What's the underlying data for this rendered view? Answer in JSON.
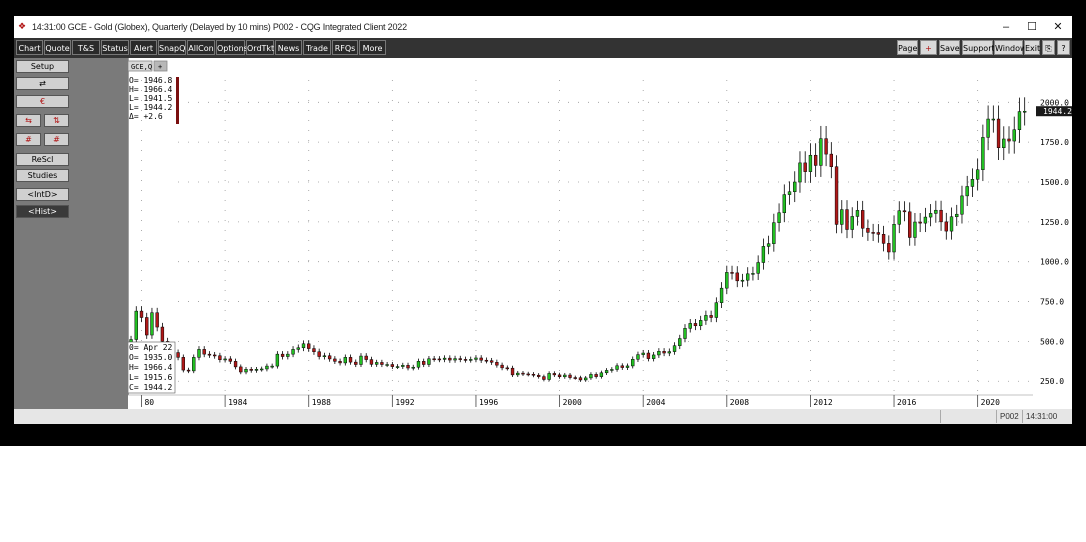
{
  "window": {
    "title": "14:31:00   GCE - Gold (Globex), Quarterly (Delayed by 10 mins)   P002 - CQG Integrated Client 2022",
    "minimize": "–",
    "maximize": "☐",
    "close": "✕"
  },
  "toolbar": {
    "left": [
      "Chart",
      "Quote",
      "T&S",
      "Status",
      "Alert",
      "SnapQ",
      "AllCon",
      "Options",
      "OrdTkt",
      "News",
      "Trade",
      "RFQs",
      "More"
    ],
    "right": [
      "Page",
      "+",
      "Save",
      "Support",
      "Window",
      "Exit",
      "⎘",
      "?"
    ]
  },
  "sidebar": {
    "setup": "Setup",
    "icon1": "⇄",
    "icon2": "€",
    "icon3a": "⇆",
    "icon3b": "⇅",
    "icon4a": "#",
    "icon4b": "#",
    "rescl": "ReScl",
    "studies": "Studies",
    "intd": "<IntD>",
    "hist": "<Hist>"
  },
  "symbol_tab": "GCE,Q",
  "quote_box": {
    "o": "O=  1946.8",
    "h": "H=  1966.4",
    "l": "L=  1941.5",
    "c": "L=  1944.2",
    "d": "Δ=    +2.6"
  },
  "cursor_box": {
    "date": "0=  Apr 22",
    "o": "O=  1935.0",
    "h": "H=  1966.4",
    "l": "L=  1915.6",
    "c": "C=  1944.2"
  },
  "last_price_label": "1944.2",
  "statusbar": {
    "page": "P002",
    "time": "14:31:00"
  },
  "colors": {
    "up": "#22c022",
    "down": "#b01818",
    "grid": "#999999",
    "frame": "#000000",
    "panel": "#7a7a7a"
  },
  "chart_data": {
    "type": "candlestick",
    "title": "GCE - Gold (Globex), Quarterly",
    "y_ticks": [
      250,
      500,
      750,
      1000,
      1250,
      1500,
      1750,
      2000
    ],
    "y_tick_labels": [
      "250.0",
      "500.0",
      "750.0",
      "1000.0",
      "1250.0",
      "1500.0",
      "1750.0",
      "2000.0"
    ],
    "ylim": [
      170,
      2140
    ],
    "x_ticks": [
      1980,
      1984,
      1988,
      1992,
      1996,
      2000,
      2004,
      2008,
      2012,
      2016,
      2020
    ],
    "x_tick_labels": [
      "80",
      "1984",
      "1988",
      "1992",
      "1996",
      "2000",
      "2004",
      "2008",
      "2012",
      "2016",
      "2020"
    ],
    "xlim": [
      1979.45,
      2022.6
    ],
    "grid": true,
    "last_price": 1944.2,
    "series_points": [
      [
        1979.5,
        512
      ],
      [
        1979.75,
        690
      ],
      [
        1980.0,
        650
      ],
      [
        1980.25,
        540
      ],
      [
        1980.5,
        680
      ],
      [
        1980.75,
        590
      ],
      [
        1981.0,
        500
      ],
      [
        1981.25,
        430
      ],
      [
        1981.5,
        430
      ],
      [
        1981.75,
        400
      ],
      [
        1982.0,
        320
      ],
      [
        1982.25,
        315
      ],
      [
        1982.5,
        400
      ],
      [
        1982.75,
        450
      ],
      [
        1983.0,
        420
      ],
      [
        1983.25,
        415
      ],
      [
        1983.5,
        410
      ],
      [
        1983.75,
        385
      ],
      [
        1984.0,
        390
      ],
      [
        1984.25,
        375
      ],
      [
        1984.5,
        340
      ],
      [
        1984.75,
        308
      ],
      [
        1985.0,
        325
      ],
      [
        1985.25,
        318
      ],
      [
        1985.5,
        325
      ],
      [
        1985.75,
        327
      ],
      [
        1986.0,
        345
      ],
      [
        1986.25,
        345
      ],
      [
        1986.5,
        420
      ],
      [
        1986.75,
        405
      ],
      [
        1987.0,
        420
      ],
      [
        1987.25,
        450
      ],
      [
        1987.5,
        460
      ],
      [
        1987.75,
        485
      ],
      [
        1988.0,
        455
      ],
      [
        1988.25,
        435
      ],
      [
        1988.5,
        405
      ],
      [
        1988.75,
        410
      ],
      [
        1989.0,
        390
      ],
      [
        1989.25,
        375
      ],
      [
        1989.5,
        365
      ],
      [
        1989.75,
        400
      ],
      [
        1990.0,
        370
      ],
      [
        1990.25,
        355
      ],
      [
        1990.5,
        408
      ],
      [
        1990.75,
        386
      ],
      [
        1991.0,
        356
      ],
      [
        1991.25,
        368
      ],
      [
        1991.5,
        355
      ],
      [
        1991.75,
        355
      ],
      [
        1992.0,
        342
      ],
      [
        1992.25,
        342
      ],
      [
        1992.5,
        350
      ],
      [
        1992.75,
        333
      ],
      [
        1993.0,
        338
      ],
      [
        1993.25,
        375
      ],
      [
        1993.5,
        355
      ],
      [
        1993.75,
        391
      ],
      [
        1994.0,
        390
      ],
      [
        1994.25,
        387
      ],
      [
        1994.5,
        395
      ],
      [
        1994.75,
        383
      ],
      [
        1995.0,
        392
      ],
      [
        1995.25,
        387
      ],
      [
        1995.5,
        384
      ],
      [
        1995.75,
        387
      ],
      [
        1996.0,
        396
      ],
      [
        1996.25,
        382
      ],
      [
        1996.5,
        379
      ],
      [
        1996.75,
        369
      ],
      [
        1997.0,
        351
      ],
      [
        1997.25,
        334
      ],
      [
        1997.5,
        332
      ],
      [
        1997.75,
        290
      ],
      [
        1998.0,
        301
      ],
      [
        1998.25,
        296
      ],
      [
        1998.5,
        294
      ],
      [
        1998.75,
        288
      ],
      [
        1999.0,
        279
      ],
      [
        1999.25,
        261
      ],
      [
        1999.5,
        299
      ],
      [
        1999.75,
        290
      ],
      [
        2000.0,
        278
      ],
      [
        2000.25,
        289
      ],
      [
        2000.5,
        273
      ],
      [
        2000.75,
        272
      ],
      [
        2001.0,
        258
      ],
      [
        2001.25,
        271
      ],
      [
        2001.5,
        293
      ],
      [
        2001.75,
        279
      ],
      [
        2002.0,
        303
      ],
      [
        2002.25,
        318
      ],
      [
        2002.5,
        324
      ],
      [
        2002.75,
        347
      ],
      [
        2003.0,
        336
      ],
      [
        2003.25,
        346
      ],
      [
        2003.5,
        388
      ],
      [
        2003.75,
        417
      ],
      [
        2004.0,
        427
      ],
      [
        2004.25,
        392
      ],
      [
        2004.5,
        415
      ],
      [
        2004.75,
        438
      ],
      [
        2005.0,
        427
      ],
      [
        2005.25,
        436
      ],
      [
        2005.5,
        473
      ],
      [
        2005.75,
        518
      ],
      [
        2006.0,
        582
      ],
      [
        2006.25,
        613
      ],
      [
        2006.5,
        598
      ],
      [
        2006.75,
        632
      ],
      [
        2007.0,
        663
      ],
      [
        2007.25,
        650
      ],
      [
        2007.5,
        743
      ],
      [
        2007.75,
        834
      ],
      [
        2008.0,
        933
      ],
      [
        2008.25,
        930
      ],
      [
        2008.5,
        880
      ],
      [
        2008.75,
        884
      ],
      [
        2009.0,
        924
      ],
      [
        2009.25,
        927
      ],
      [
        2009.5,
        995
      ],
      [
        2009.75,
        1096
      ],
      [
        2010.0,
        1113
      ],
      [
        2010.25,
        1245
      ],
      [
        2010.5,
        1307
      ],
      [
        2010.75,
        1421
      ],
      [
        2011.0,
        1439
      ],
      [
        2011.25,
        1500
      ],
      [
        2011.5,
        1620
      ],
      [
        2011.75,
        1565
      ],
      [
        2012.0,
        1668
      ],
      [
        2012.25,
        1604
      ],
      [
        2012.5,
        1772
      ],
      [
        2012.75,
        1675
      ],
      [
        2013.0,
        1596
      ],
      [
        2013.25,
        1234
      ],
      [
        2013.5,
        1327
      ],
      [
        2013.75,
        1202
      ],
      [
        2014.0,
        1284
      ],
      [
        2014.25,
        1322
      ],
      [
        2014.5,
        1210
      ],
      [
        2014.75,
        1184
      ],
      [
        2015.0,
        1183
      ],
      [
        2015.25,
        1172
      ],
      [
        2015.5,
        1115
      ],
      [
        2015.75,
        1061
      ],
      [
        2016.0,
        1235
      ],
      [
        2016.25,
        1320
      ],
      [
        2016.5,
        1313
      ],
      [
        2016.75,
        1152
      ],
      [
        2017.0,
        1249
      ],
      [
        2017.25,
        1242
      ],
      [
        2017.5,
        1280
      ],
      [
        2017.75,
        1303
      ],
      [
        2018.0,
        1323
      ],
      [
        2018.25,
        1250
      ],
      [
        2018.5,
        1192
      ],
      [
        2018.75,
        1282
      ],
      [
        2019.0,
        1298
      ],
      [
        2019.25,
        1413
      ],
      [
        2019.5,
        1472
      ],
      [
        2019.75,
        1517
      ],
      [
        2020.0,
        1577
      ],
      [
        2020.25,
        1780
      ],
      [
        2020.5,
        1895
      ],
      [
        2020.75,
        1895
      ],
      [
        2021.0,
        1715
      ],
      [
        2021.25,
        1770
      ],
      [
        2021.5,
        1757
      ],
      [
        2021.75,
        1828
      ],
      [
        2022.0,
        1942
      ],
      [
        2022.25,
        1944
      ]
    ]
  }
}
